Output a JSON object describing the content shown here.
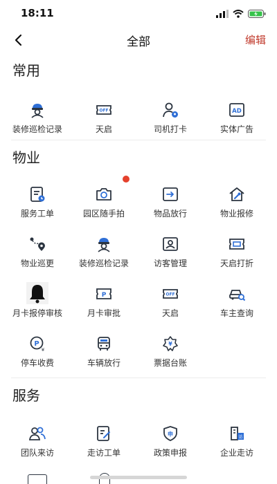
{
  "status_bar": {
    "time": "18:11",
    "battery_color": "#36c24a"
  },
  "nav": {
    "title": "全部",
    "edit_label": "编辑",
    "edit_color": "#c0392b"
  },
  "sections": {
    "common": {
      "title": "常用",
      "items": [
        {
          "label": "装修巡检记录",
          "icon": "worker-helmet-icon"
        },
        {
          "label": "天启",
          "icon": "off-ticket-icon"
        },
        {
          "label": "司机打卡",
          "icon": "driver-checkin-icon"
        },
        {
          "label": "实体广告",
          "icon": "ad-icon"
        }
      ]
    },
    "property": {
      "title": "物业",
      "items": [
        {
          "label": "服务工单",
          "icon": "service-order-icon"
        },
        {
          "label": "园区随手拍",
          "icon": "camera-icon"
        },
        {
          "label": "物品放行",
          "icon": "item-release-icon"
        },
        {
          "label": "物业报修",
          "icon": "repair-house-icon"
        },
        {
          "label": "物业巡更",
          "icon": "patrol-route-icon"
        },
        {
          "label": "装修巡检记录",
          "icon": "worker-helmet-icon"
        },
        {
          "label": "访客管理",
          "icon": "visitor-id-icon"
        },
        {
          "label": "天启打折",
          "icon": "ticket-discount-icon"
        },
        {
          "label": "月卡报停审核",
          "icon": "bell-icon"
        },
        {
          "label": "月卡审批",
          "icon": "parking-card-icon"
        },
        {
          "label": "天启",
          "icon": "off-ticket-icon"
        },
        {
          "label": "车主查询",
          "icon": "car-search-icon"
        },
        {
          "label": "停车收费",
          "icon": "parking-fee-icon"
        },
        {
          "label": "车辆放行",
          "icon": "bus-icon"
        },
        {
          "label": "票据台账",
          "icon": "bill-ledger-icon"
        }
      ]
    },
    "service": {
      "title": "服务",
      "items": [
        {
          "label": "团队来访",
          "icon": "team-icon"
        },
        {
          "label": "走访工单",
          "icon": "edit-form-icon"
        },
        {
          "label": "政策申报",
          "icon": "shield-declare-icon"
        },
        {
          "label": "企业走访",
          "icon": "building-visit-icon"
        }
      ]
    }
  },
  "colors": {
    "icon_dark": "#2b3440",
    "icon_blue": "#2f6fd6",
    "accent_red": "#e5412d"
  }
}
